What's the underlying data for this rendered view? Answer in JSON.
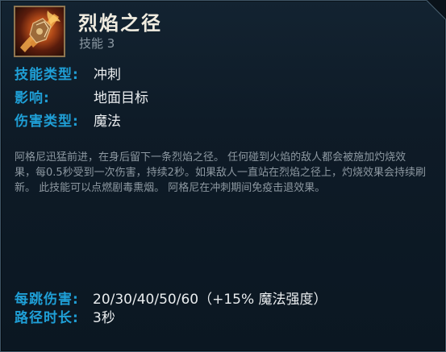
{
  "ability": {
    "name": "烈焰之径",
    "slot": "技能 3",
    "icon": "flaming-gauntlet-icon"
  },
  "stats": [
    {
      "label": "技能类型:",
      "value": "冲刺"
    },
    {
      "label": "影响:",
      "value": "地面目标"
    },
    {
      "label": "伤害类型:",
      "value": "魔法"
    }
  ],
  "description": "阿格尼迅猛前进，在身后留下一条烈焰之径。 任何碰到火焰的敌人都会被施加灼烧效果，每0.5秒受到一次伤害，持续2秒。如果敌人一直站在烈焰之径上，灼烧效果会持续刷新。 此技能可以点燃剧毒熏烟。 阿格尼在冲刺期间免疫击退效果。",
  "scaling": [
    {
      "label": "每跳伤害:",
      "value": "20/30/40/50/60（+15% 魔法强度）"
    },
    {
      "label": "路径时长:",
      "value": "3秒"
    }
  ],
  "colors": {
    "label": "#1f9fd6",
    "value": "#e9ecee",
    "description": "#8d98a1",
    "background": "#0e1b27",
    "border": "#3f5566"
  }
}
